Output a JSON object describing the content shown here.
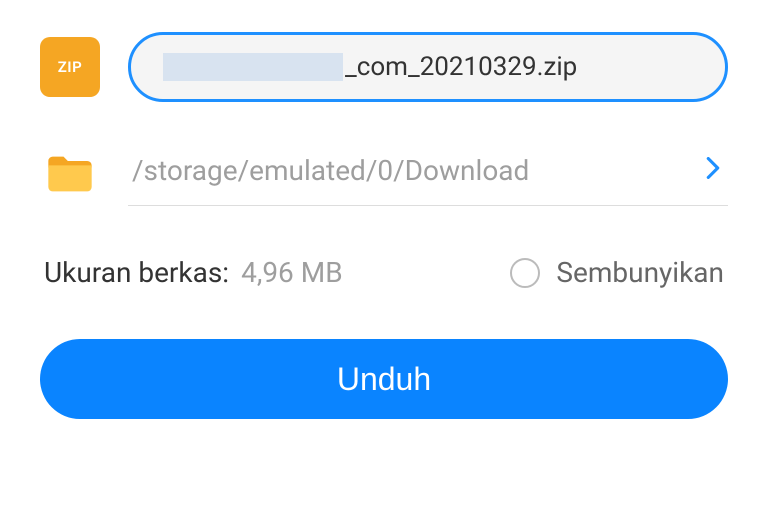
{
  "file": {
    "icon_label": "ZIP",
    "filename_suffix": "_com_20210329.zip"
  },
  "destination": {
    "path": "/storage/emulated/0/Download"
  },
  "filesize": {
    "label": "Ukuran berkas:",
    "value": "4,96 MB"
  },
  "hide": {
    "label": "Sembunyikan"
  },
  "action": {
    "download_label": "Unduh"
  }
}
